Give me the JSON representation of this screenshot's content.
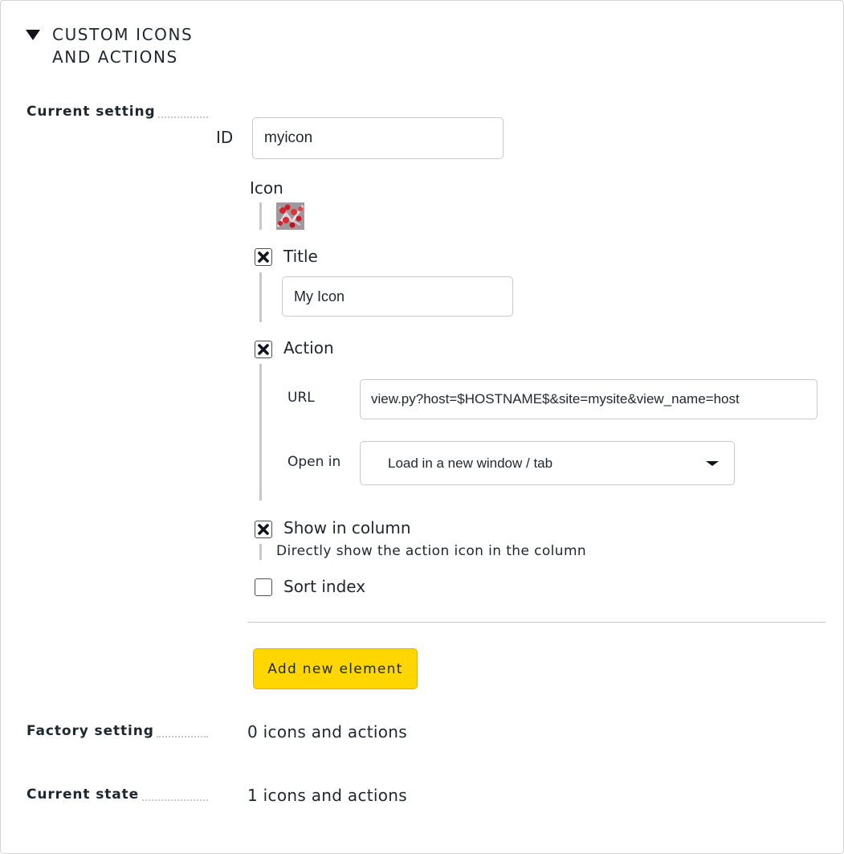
{
  "section": {
    "title": "CUSTOM ICONS AND ACTIONS",
    "title_line1": "CUSTOM ICONS",
    "title_line2": "AND ACTIONS"
  },
  "labels": {
    "current_setting": "Current setting",
    "factory_setting": "Factory setting",
    "current_state": "Current state"
  },
  "form": {
    "id_label": "ID",
    "id_value": "myicon",
    "icon_label": "Icon",
    "title_label": "Title",
    "title_checked": true,
    "title_value": "My Icon",
    "action_label": "Action",
    "action_checked": true,
    "url_label": "URL",
    "url_value": "view.py?host=$HOSTNAME$&site=mysite&view_name=host",
    "open_in_label": "Open in",
    "open_in_value": "Load in a new window / tab",
    "show_in_column_label": "Show in column",
    "show_in_column_checked": true,
    "show_in_column_help": "Directly show the action icon in the column",
    "sort_index_label": "Sort index",
    "sort_index_checked": false
  },
  "buttons": {
    "add_new_element": "Add new element"
  },
  "values": {
    "factory_setting": "0 icons and actions",
    "current_state": "1 icons and actions"
  },
  "colors": {
    "accent_button": "#ffd600",
    "text": "#1e262e"
  }
}
